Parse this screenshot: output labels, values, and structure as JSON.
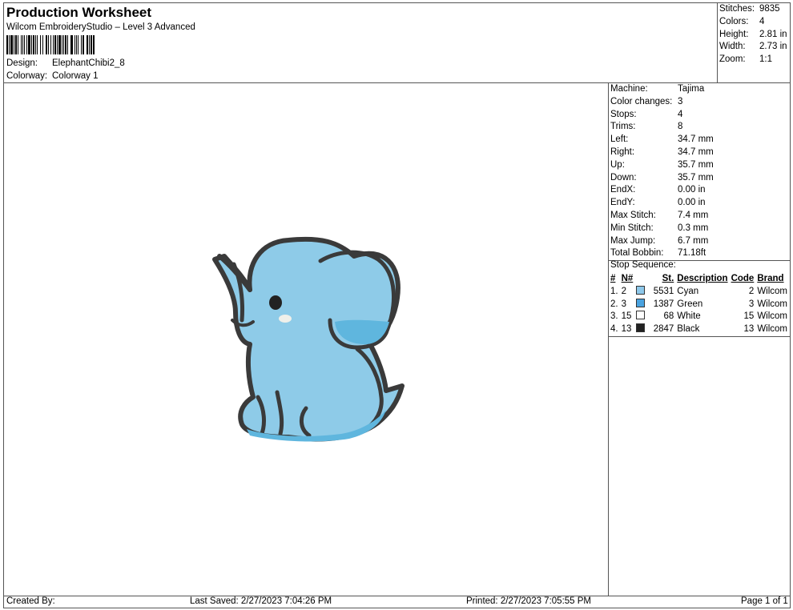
{
  "header": {
    "title": "Production Worksheet",
    "software": "Wilcom EmbroideryStudio – Level 3 Advanced",
    "design_label": "Design:",
    "design_value": "ElephantChibi2_8",
    "colorway_label": "Colorway:",
    "colorway_value": "Colorway 1"
  },
  "summary": [
    {
      "label": "Stitches:",
      "value": "9835"
    },
    {
      "label": "Colors:",
      "value": "4"
    },
    {
      "label": "Height:",
      "value": "2.81 in"
    },
    {
      "label": "Width:",
      "value": "2.73 in"
    },
    {
      "label": "Zoom:",
      "value": "1:1"
    }
  ],
  "details": [
    {
      "label": "Machine:",
      "value": "Tajima"
    },
    {
      "label": "Color changes:",
      "value": "3"
    },
    {
      "label": "Stops:",
      "value": "4"
    },
    {
      "label": "Trims:",
      "value": "8"
    },
    {
      "label": "Left:",
      "value": "34.7 mm"
    },
    {
      "label": "Right:",
      "value": "34.7 mm"
    },
    {
      "label": "Up:",
      "value": "35.7 mm"
    },
    {
      "label": "Down:",
      "value": "35.7 mm"
    },
    {
      "label": "EndX:",
      "value": "0.00 in"
    },
    {
      "label": "EndY:",
      "value": "0.00 in"
    },
    {
      "label": "Max Stitch:",
      "value": "7.4 mm"
    },
    {
      "label": "Min Stitch:",
      "value": "0.3 mm"
    },
    {
      "label": "Max Jump:",
      "value": "6.7 mm"
    },
    {
      "label": "Total Bobbin:",
      "value": "71.18ft"
    }
  ],
  "stop_sequence": {
    "title": "Stop Sequence:",
    "headers": [
      "#",
      "N#",
      "St.",
      "Description",
      "Code",
      "Brand"
    ],
    "rows": [
      {
        "idx": "1.",
        "n": "2",
        "color": "#8ec8ea",
        "st": "5531",
        "desc": "Cyan",
        "code": "2",
        "brand": "Wilcom"
      },
      {
        "idx": "2.",
        "n": "3",
        "color": "#4aa3e0",
        "st": "1387",
        "desc": "Green",
        "code": "3",
        "brand": "Wilcom"
      },
      {
        "idx": "3.",
        "n": "15",
        "color": "#ffffff",
        "st": "68",
        "desc": "White",
        "code": "15",
        "brand": "Wilcom"
      },
      {
        "idx": "4.",
        "n": "13",
        "color": "#222222",
        "st": "2847",
        "desc": "Black",
        "code": "13",
        "brand": "Wilcom"
      }
    ]
  },
  "footer": {
    "created_by": "Created By:",
    "last_saved": "Last Saved: 2/27/2023 7:04:26 PM",
    "printed": "Printed: 2/27/2023 7:05:55 PM",
    "page": "Page 1 of 1"
  },
  "colors": {
    "body_fill": "#8ecbe8",
    "outline": "#3a3a3a",
    "shadow": "#5fb6de"
  }
}
